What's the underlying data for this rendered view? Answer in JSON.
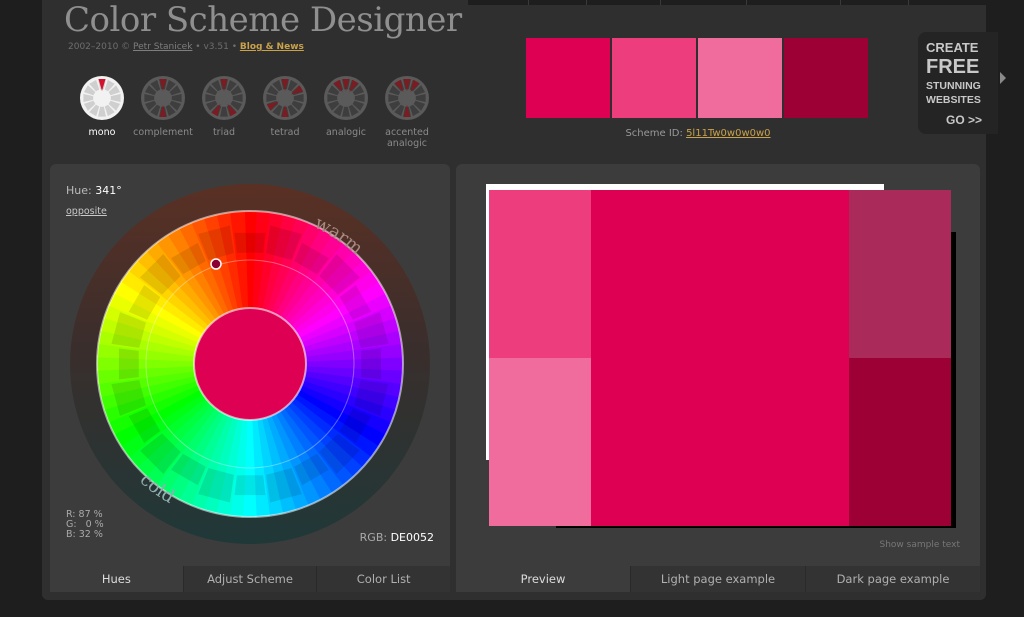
{
  "app": {
    "title": "Color Scheme Designer",
    "credits_prefix": "2002–2010 © ",
    "author": "Petr Stanicek",
    "version": " • v3.51 • ",
    "blog_link": "Blog & News"
  },
  "modes": [
    {
      "label": "mono",
      "active": true
    },
    {
      "label": "complement",
      "active": false
    },
    {
      "label": "triad",
      "active": false
    },
    {
      "label": "tetrad",
      "active": false
    },
    {
      "label": "analogic",
      "active": false
    },
    {
      "label": "accented analogic",
      "active": false
    }
  ],
  "scheme": {
    "colors": [
      "#DE0052",
      "#EE3D7D",
      "#F06C9D",
      "#9C0035"
    ],
    "id_label": "Scheme ID: ",
    "id_value": "5l11Tw0w0w0w0"
  },
  "ad": {
    "lines": [
      "CREATE",
      "FREE",
      "STUNNING",
      "WEBSITES",
      "GO >>"
    ]
  },
  "wheel": {
    "hue_label": "Hue: ",
    "hue_value": "341°",
    "opposite_link": "opposite",
    "warm_label": "warm",
    "cold_label": "cold",
    "rgb_readout": "R: 87 %\nG:   0 %\nB: 32 %",
    "rgb_label": "RGB: ",
    "rgb_value": "DE0052",
    "center_color": "#DE0052"
  },
  "left_tabs": [
    {
      "label": "Hues",
      "active": true
    },
    {
      "label": "Adjust Scheme",
      "active": false
    },
    {
      "label": "Color List",
      "active": false
    }
  ],
  "preview": {
    "colors": {
      "primary": "#DE0052",
      "light": "#EE3D7D",
      "lighter": "#F06C9D",
      "muted": "#AA2A5A",
      "dark": "#9C0035"
    },
    "show_sample_text": "Show sample text"
  },
  "right_tabs": [
    {
      "label": "Preview",
      "active": true
    },
    {
      "label": "Light page example",
      "active": false
    },
    {
      "label": "Dark page example",
      "active": false
    }
  ]
}
